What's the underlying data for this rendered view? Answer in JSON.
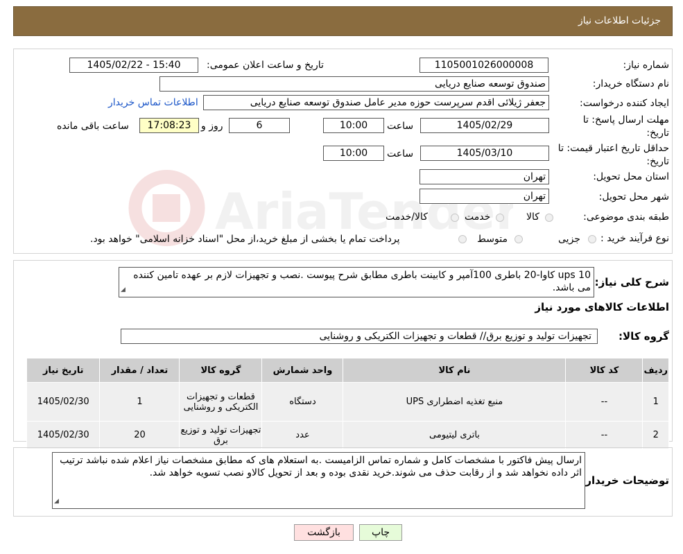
{
  "header": {
    "title": "جزئیات اطلاعات نیاز"
  },
  "fields": {
    "need_number_label": "شماره نیاز:",
    "need_number": "1105001026000008",
    "announce_label": "تاریخ و ساعت اعلان عمومی:",
    "announce_value": "1405/02/22 - 15:40",
    "buyer_label": "نام دستگاه خریدار:",
    "buyer_value": "صندوق توسعه صنایع دریایی",
    "requester_label": "ایجاد کننده درخواست:",
    "requester_value": "جعفر ژیلائی اقدم سرپرست حوزه مدیر عامل صندوق توسعه صنایع دریایی",
    "contact_link": "اطلاعات تماس خریدار",
    "deadline_label_1": "مهلت ارسال پاسخ: تا",
    "deadline_label_2": "تاریخ:",
    "deadline_date": "1405/02/29",
    "hour_label": "ساعت",
    "deadline_time": "10:00",
    "days_value": "6",
    "days_label": "روز و",
    "remaining_time": "17:08:23",
    "remaining_label": "ساعت باقی مانده",
    "validity_label_1": "حداقل تاریخ اعتبار قیمت: تا",
    "validity_label_2": "تاریخ:",
    "validity_date": "1405/03/10",
    "validity_time": "10:00",
    "province_label": "استان محل تحویل:",
    "province_value": "تهران",
    "city_label": "شهر محل تحویل:",
    "city_value": "تهران",
    "category_label": "طبقه بندی موضوعی:",
    "category_options": [
      "کالا",
      "خدمت",
      "کالا/خدمت"
    ],
    "purchase_type_label": "نوع فرآیند خرید :",
    "purchase_options": [
      "جزیی",
      "متوسط"
    ],
    "payment_note": "پرداخت تمام یا بخشی از مبلغ خرید،از محل \"اسناد خزانه اسلامی\" خواهد بود."
  },
  "summary": {
    "label": "شرح کلی نیاز:",
    "text": "ups 10 کاوا-20 باطری  100آمپر و کابینت باطری  مطابق شرح پیوست .نصب و تجهیزات لازم بر عهده تامین کننده می باشد."
  },
  "goods": {
    "section_title": "اطلاعات کالاهای مورد نیاز",
    "group_label": "گروه کالا:",
    "group_value": "تجهیزات تولید و توزیع برق// قطعات و تجهیزات الکتریکی و روشنایی"
  },
  "table": {
    "headers": [
      "ردیف",
      "کد کالا",
      "نام کالا",
      "واحد شمارش",
      "گروه کالا",
      "تعداد / مقدار",
      "تاریخ نیاز"
    ],
    "rows": [
      [
        "1",
        "--",
        "منبع تغذیه اضطراری UPS",
        "دستگاه",
        "قطعات و تجهیزات الکتریکی و روشنایی",
        "1",
        "1405/02/30"
      ],
      [
        "2",
        "--",
        "باتری لیتیومی",
        "عدد",
        "تجهیزات تولید و توزیع برق",
        "20",
        "1405/02/30"
      ]
    ]
  },
  "buyer_notes": {
    "label": "توضیحات خریدار:",
    "text": "ارسال پیش فاکتور با مشخصات کامل و شماره تماس الزامیست .به استعلام های که مطابق مشخصات نیاز اعلام شده نباشد ترتیب اثر داده نخواهد شد و از رقابت حذف می شوند.خرید نقدی بوده و بعد از تحویل کالاو نصب تسویه خواهد شد."
  },
  "buttons": {
    "print": "چاپ",
    "back": "بازگشت"
  },
  "watermark": {
    "text": "AriaTender.neT"
  },
  "colors": {
    "header_bg": "#8a6c3f",
    "print_btn": "#e6fbd9",
    "back_btn": "#ffe0e0",
    "link": "#1a55c8"
  }
}
